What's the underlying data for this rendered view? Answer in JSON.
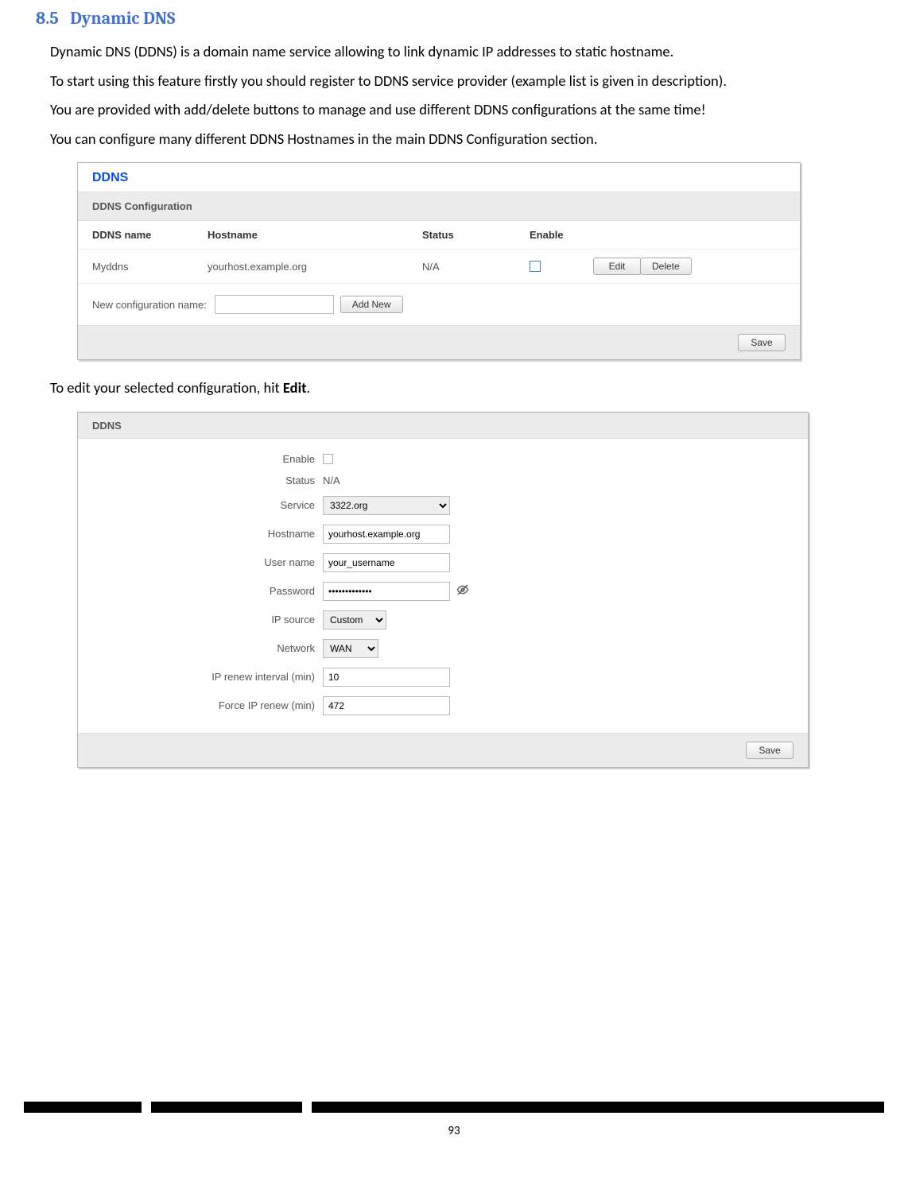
{
  "section": {
    "number": "8.5",
    "title": "Dynamic DNS"
  },
  "paragraphs": {
    "p1": "Dynamic DNS (DDNS) is a domain name service allowing to link dynamic IP addresses to static hostname.",
    "p2": "To start using this feature firstly you should register to DDNS service provider (example list is given in description).",
    "p3": "You are provided with add/delete buttons to manage and use different DDNS configurations at the same time!",
    "p4": "You can configure many different DDNS Hostnames in the main DDNS Configuration section.",
    "p5_pre": "To edit your selected configuration, hit ",
    "p5_bold": "Edit",
    "p5_post": "."
  },
  "panel1": {
    "title": "DDNS",
    "subheader": "DDNS Configuration",
    "headers": {
      "name": "DDNS name",
      "host": "Hostname",
      "status": "Status",
      "enable": "Enable"
    },
    "row": {
      "name": "Myddns",
      "host": "yourhost.example.org",
      "status": "N/A"
    },
    "buttons": {
      "edit": "Edit",
      "delete": "Delete",
      "addnew": "Add New",
      "save": "Save"
    },
    "newconfig_label": "New configuration name:"
  },
  "panel2": {
    "title": "DDNS",
    "labels": {
      "enable": "Enable",
      "status": "Status",
      "service": "Service",
      "hostname": "Hostname",
      "username": "User name",
      "password": "Password",
      "ipsource": "IP source",
      "network": "Network",
      "iprenew": "IP renew interval (min)",
      "forceip": "Force IP renew (min)"
    },
    "values": {
      "status": "N/A",
      "service": "3322.org",
      "hostname": "yourhost.example.org",
      "username": "your_username",
      "password": "•••••••••••••",
      "ipsource": "Custom",
      "network": "WAN",
      "iprenew": "10",
      "forceip": "472"
    },
    "save": "Save"
  },
  "pagenum": "93"
}
